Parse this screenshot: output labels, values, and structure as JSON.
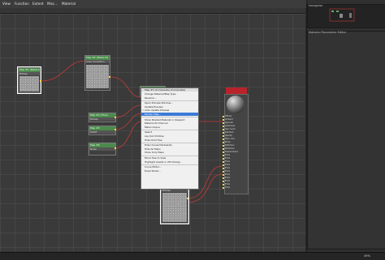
{
  "menu": {
    "items": [
      "View",
      "Function",
      "Extent",
      "Misc...",
      "Material"
    ]
  },
  "right_panel": {
    "navigator_title": "Navigator",
    "parameter_title": "Material Parameter Editor"
  },
  "nodes": {
    "left_bitmap": {
      "title": "Map #1 (Metal.tif)",
      "subtitle": "Bitmap"
    },
    "top_bitmap": {
      "title": "Map #2 (Metal.tif)",
      "subtitle": "Color Correction"
    },
    "mid_composite": {
      "title": "Map #3 (Composite)",
      "subtitle": "Composite"
    },
    "small1": {
      "title": "Map #4 (Tiles)",
      "subtitle": "Bitmap"
    },
    "small2": {
      "title": "Map #5",
      "subtitle": "Falloff"
    },
    "small3": {
      "title": "Map #6",
      "subtitle": "Noise"
    },
    "bottom_bitmap": {
      "title": "Map #7 (Metal.tif)",
      "subtitle": "Bitmap"
    }
  },
  "context_menu": {
    "title": "Map #3 (Composite) (Composite)",
    "items": [
      "Change Material/Map Type",
      "Rename...",
      "",
      "Open Preview Window...",
      "Update Preview",
      "Auto Update Preview",
      "Render Map...",
      "",
      "Show Shaded Material in Viewport",
      "Material ID Channel",
      "Make Unique",
      "",
      "Select",
      "Lay Out Children",
      "Hide Child Tree",
      "",
      "Hide Unused Nodeslots",
      "Hide All Maps",
      "Show Only Maps",
      "",
      "Move Tree to View",
      "Highlight Assets in ATS Dialog...",
      "",
      "Curve Editor...",
      "Dope Sheet..."
    ],
    "highlighted_index": 6,
    "checked_index": 5
  },
  "material_node": {
    "slots": [
      "Diffuse",
      "Ambient",
      "Specular",
      "Glossiness",
      "Spec Level",
      "Self-Illum",
      "Opacity",
      "Filter color",
      "Bump",
      "Reflection",
      "Refraction",
      "Displacement",
      "Extra",
      "Extra",
      "Extra",
      "Extra",
      "Extra",
      "Extra",
      "Extra",
      "Extra",
      "Extra",
      "Extra",
      "Extra"
    ]
  },
  "status": {
    "zoom": "49%"
  },
  "colors": {
    "node_header": "#4c8a4c",
    "wire": "#c23b35",
    "highlight": "#3b7bd8",
    "material_banner": "#b8232a",
    "socket": "#ffd84a"
  },
  "icons": [
    "check-icon",
    "material-sphere-icon"
  ]
}
